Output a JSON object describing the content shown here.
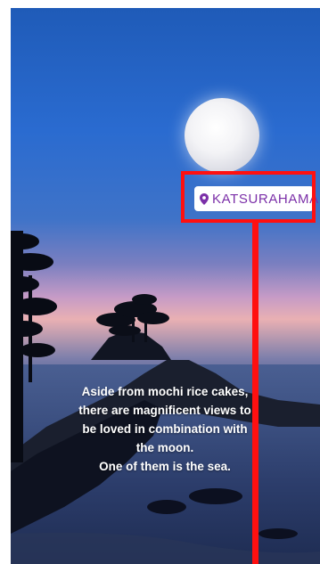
{
  "location_sticker": {
    "icon": "map-pin-icon",
    "label": "KATSURAHAMA",
    "color": "#7b2fa8"
  },
  "caption": {
    "lines": [
      "Aside from mochi rice cakes,",
      "there are magnificent views to",
      "be loved in combination with",
      "the moon.",
      "One of them is the sea."
    ]
  },
  "colors": {
    "highlight": "#ff1010"
  }
}
